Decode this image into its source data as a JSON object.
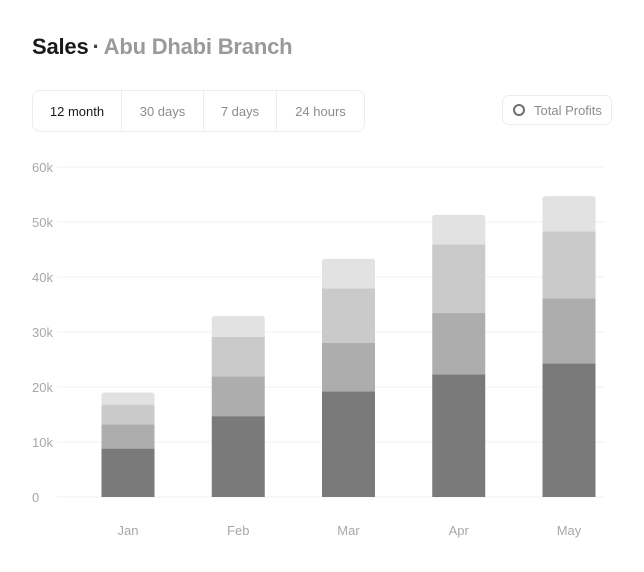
{
  "header": {
    "title": "Sales",
    "separator": "·",
    "subtitle": "Abu Dhabi Branch"
  },
  "tabs": [
    {
      "label": "12 month",
      "active": true
    },
    {
      "label": "30 days",
      "active": false
    },
    {
      "label": "7 days",
      "active": false
    },
    {
      "label": "24 hours",
      "active": false
    }
  ],
  "legend_button": {
    "label": "Total Profits",
    "icon": "circle-outline-icon"
  },
  "colors": {
    "series": [
      "#7a7a7a",
      "#adadad",
      "#cacaca",
      "#e2e2e2"
    ],
    "grid": "#f2f2f2",
    "tick": "#a8a8a8"
  },
  "chart_data": {
    "type": "bar",
    "stacked": true,
    "categories": [
      "Jan",
      "Feb",
      "Mar",
      "Apr",
      "May"
    ],
    "ylim": [
      0,
      60000
    ],
    "yticks": [
      {
        "value": 0,
        "label": "0"
      },
      {
        "value": 10000,
        "label": "10k"
      },
      {
        "value": 20000,
        "label": "20k"
      },
      {
        "value": 30000,
        "label": "30k"
      },
      {
        "value": 40000,
        "label": "40k"
      },
      {
        "value": 50000,
        "label": "50k"
      },
      {
        "value": 60000,
        "label": "60k"
      }
    ],
    "grid": true,
    "series": [
      {
        "values": [
          8800,
          14700,
          19200,
          22300,
          24300
        ]
      },
      {
        "values": [
          4400,
          7200,
          8800,
          11200,
          11800
        ]
      },
      {
        "values": [
          3600,
          7200,
          9900,
          12400,
          12200
        ]
      },
      {
        "values": [
          2200,
          3800,
          5400,
          5400,
          6400
        ]
      }
    ]
  }
}
